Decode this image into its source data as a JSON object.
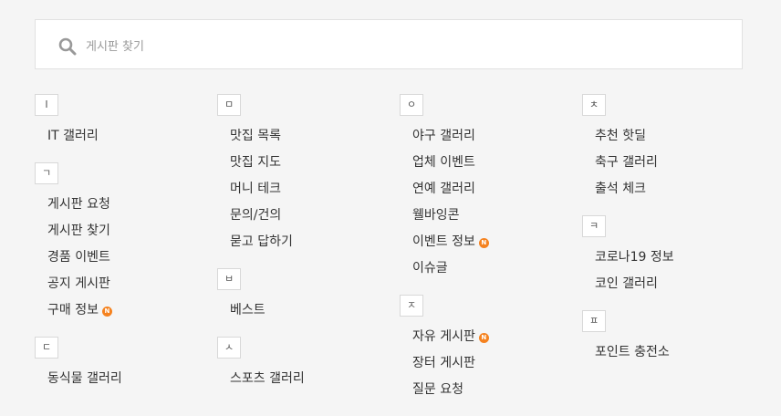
{
  "search": {
    "placeholder": "게시판 찾기"
  },
  "columns": [
    {
      "groups": [
        {
          "letter": "I",
          "items": [
            {
              "label": "IT 갤러리"
            }
          ]
        },
        {
          "letter": "ㄱ",
          "items": [
            {
              "label": "게시판 요청"
            },
            {
              "label": "게시판 찾기"
            },
            {
              "label": "경품 이벤트"
            },
            {
              "label": "공지 게시판"
            },
            {
              "label": "구매 정보",
              "new": true
            }
          ]
        },
        {
          "letter": "ㄷ",
          "items": [
            {
              "label": "동식물 갤러리"
            }
          ]
        }
      ]
    },
    {
      "groups": [
        {
          "letter": "ㅁ",
          "items": [
            {
              "label": "맛집 목록"
            },
            {
              "label": "맛집 지도"
            },
            {
              "label": "머니 테크"
            },
            {
              "label": "문의/건의"
            },
            {
              "label": "묻고 답하기"
            }
          ]
        },
        {
          "letter": "ㅂ",
          "items": [
            {
              "label": "베스트"
            }
          ]
        },
        {
          "letter": "ㅅ",
          "items": [
            {
              "label": "스포츠 갤러리"
            }
          ]
        }
      ]
    },
    {
      "groups": [
        {
          "letter": "ㅇ",
          "items": [
            {
              "label": "야구 갤러리"
            },
            {
              "label": "업체 이벤트"
            },
            {
              "label": "연예 갤러리"
            },
            {
              "label": "웰바잉콘"
            },
            {
              "label": "이벤트 정보",
              "new": true
            },
            {
              "label": "이슈글"
            }
          ]
        },
        {
          "letter": "ㅈ",
          "items": [
            {
              "label": "자유 게시판",
              "new": true
            },
            {
              "label": "장터 게시판"
            },
            {
              "label": "질문 요청"
            }
          ]
        }
      ]
    },
    {
      "groups": [
        {
          "letter": "ㅊ",
          "items": [
            {
              "label": "추천 핫딜"
            },
            {
              "label": "축구 갤러리"
            },
            {
              "label": "출석 체크"
            }
          ]
        },
        {
          "letter": "ㅋ",
          "items": [
            {
              "label": "코로나19 정보"
            },
            {
              "label": "코인 갤러리"
            }
          ]
        },
        {
          "letter": "ㅍ",
          "items": [
            {
              "label": "포인트 충전소"
            }
          ]
        }
      ]
    }
  ],
  "new_badge_text": "N",
  "colors": {
    "new_badge": "#f5821f",
    "background": "#f5f5f5",
    "search_icon": "#999999"
  }
}
